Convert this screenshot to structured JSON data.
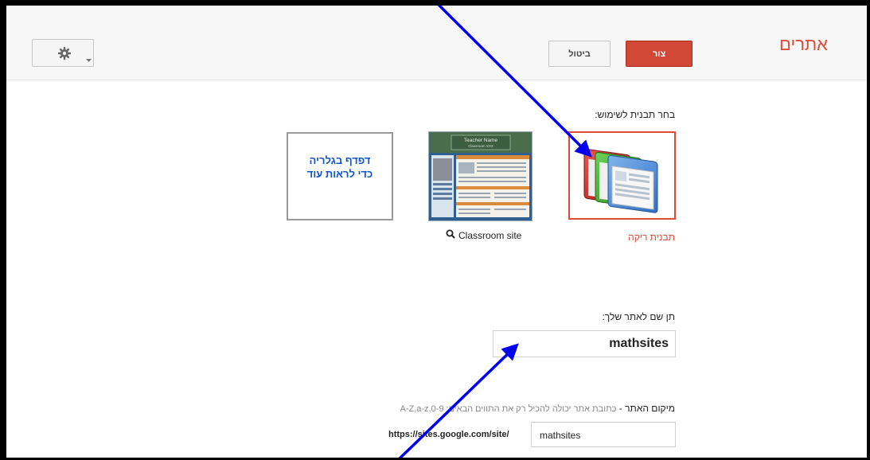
{
  "header": {
    "app_title": "אתרים",
    "create_label": "צור",
    "cancel_label": "ביטול",
    "settings_icon": "gear-icon"
  },
  "templates": {
    "choose_label": "בחר תבנית לשימוש:",
    "blank_caption": "תבנית ריקה",
    "classroom_caption": "Classroom site",
    "classroom_thumb_title": "Teacher Name",
    "classroom_thumb_subtitle": "Classroom XXX",
    "browse_line1": "דפדף בגלריה",
    "browse_line2": "כדי לראות עוד"
  },
  "site_name": {
    "label": "תן שם לאתר שלך:",
    "value": "mathsites"
  },
  "site_location": {
    "label": "מיקום האתר",
    "separator": " - ",
    "hint": "כתובת אתר יכולה להכיל רק את התווים הבאים: A-Z,a-z,0-9",
    "url_prefix": "https://sites.google.com/site/",
    "value": "mathsites"
  },
  "colors": {
    "accent_red": "#dd4b39",
    "link_blue": "#1155cc",
    "annotation_arrow": "#0000ee"
  }
}
